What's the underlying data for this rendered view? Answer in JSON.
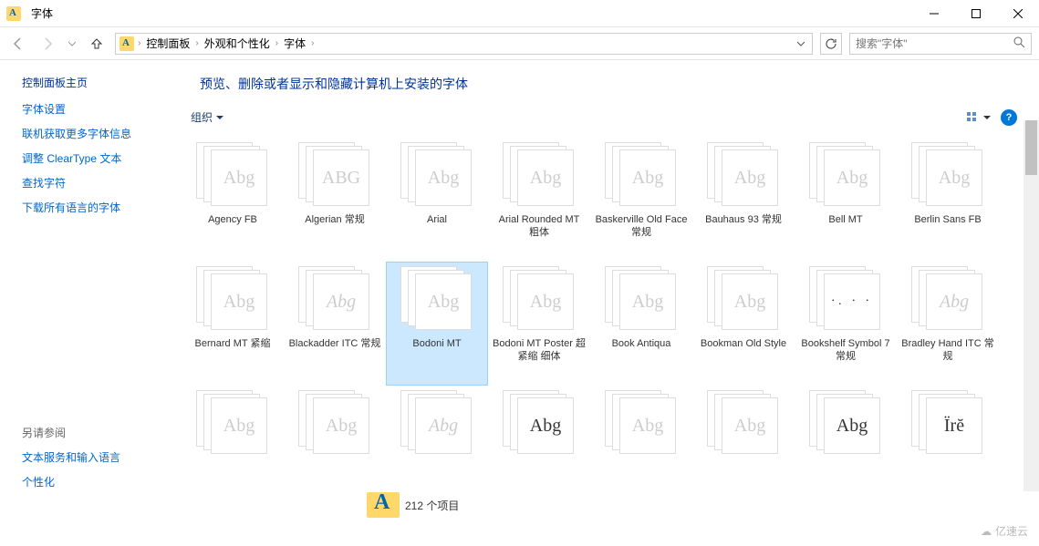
{
  "window": {
    "title": "字体",
    "min_tip": "最小化",
    "max_tip": "最大化",
    "close_tip": "关闭"
  },
  "breadcrumb": {
    "items": [
      "控制面板",
      "外观和个性化",
      "字体"
    ]
  },
  "search": {
    "placeholder": "搜索\"字体\""
  },
  "sidebar": {
    "title": "控制面板主页",
    "links": [
      "字体设置",
      "联机获取更多字体信息",
      "调整 ClearType 文本",
      "查找字符",
      "下载所有语言的字体"
    ],
    "see_also_title": "另请参阅",
    "see_also": [
      "文本服务和输入语言",
      "个性化"
    ]
  },
  "content": {
    "heading": "预览、删除或者显示和隐藏计算机上安装的字体",
    "toolbar": {
      "organize": "组织"
    }
  },
  "fonts": [
    {
      "name": "Agency FB",
      "sample": "Abg",
      "dim": true
    },
    {
      "name": "Algerian 常规",
      "sample": "ABG",
      "dim": true
    },
    {
      "name": "Arial",
      "sample": "Abg",
      "dim": true
    },
    {
      "name": "Arial Rounded MT 粗体",
      "sample": "Abg",
      "dim": true
    },
    {
      "name": "Baskerville Old Face 常规",
      "sample": "Abg",
      "dim": true
    },
    {
      "name": "Bauhaus 93 常规",
      "sample": "Abg",
      "dim": true
    },
    {
      "name": "Bell MT",
      "sample": "Abg",
      "dim": true
    },
    {
      "name": "Berlin Sans FB",
      "sample": "Abg",
      "dim": true
    },
    {
      "name": "Bernard MT 紧缩",
      "sample": "Abg",
      "dim": true
    },
    {
      "name": "Blackadder ITC 常规",
      "sample": "Abg",
      "dim": true,
      "italic": true
    },
    {
      "name": "Bodoni MT",
      "sample": "Abg",
      "dim": true,
      "selected": true
    },
    {
      "name": "Bodoni MT Poster 超紧缩 细体",
      "sample": "Abg",
      "dim": true
    },
    {
      "name": "Book Antiqua",
      "sample": "Abg",
      "dim": true
    },
    {
      "name": "Bookman Old Style",
      "sample": "Abg",
      "dim": true
    },
    {
      "name": "Bookshelf Symbol 7 常规",
      "sample": "∙. ∙ ∙",
      "dim": false,
      "symbol": true
    },
    {
      "name": "Bradley Hand ITC 常规",
      "sample": "Abg",
      "dim": true,
      "italic": true
    },
    {
      "name": "",
      "sample": "Abg",
      "dim": true
    },
    {
      "name": "",
      "sample": "Abg",
      "dim": true
    },
    {
      "name": "",
      "sample": "Abg",
      "dim": true,
      "italic": true
    },
    {
      "name": "",
      "sample": "Abg",
      "dim": false
    },
    {
      "name": "",
      "sample": "Abg",
      "dim": true
    },
    {
      "name": "",
      "sample": "Abg",
      "dim": true
    },
    {
      "name": "",
      "sample": "Abg",
      "dim": false
    },
    {
      "name": "",
      "sample": "Ïrĕ",
      "dim": false
    }
  ],
  "status": {
    "count_text": "212 个项目"
  },
  "watermark": "亿速云"
}
